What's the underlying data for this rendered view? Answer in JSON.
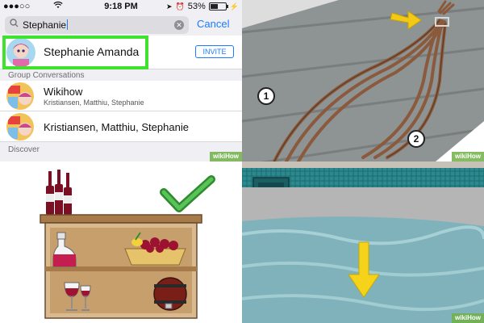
{
  "status": {
    "signal": "●●●○○",
    "time": "9:18 PM",
    "battery": "53%",
    "battery_level": 0.53
  },
  "search": {
    "value": "Stephanie",
    "cancel_label": "Cancel"
  },
  "contact": {
    "name": "Stephanie Amanda",
    "invite_label": "INVITE"
  },
  "sections": {
    "group_conversations": "Group Conversations",
    "discover": "Discover"
  },
  "groups": [
    {
      "title": "Wikihow",
      "subtitle": "Kristiansen, Matthiu, Stephanie"
    },
    {
      "title": "Kristiansen, Matthiu, Stephanie",
      "subtitle": ""
    }
  ],
  "callouts": {
    "one": "1",
    "two": "2"
  },
  "watermark": "wikiHow",
  "colors": {
    "ios_blue": "#1a7cff",
    "highlight_green": "#3fe22f",
    "wikihow_green": "#70b046"
  }
}
